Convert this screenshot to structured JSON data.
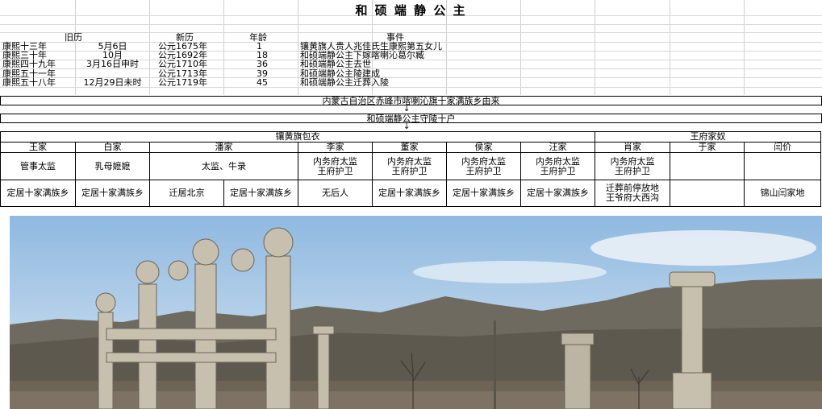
{
  "title": "和 硕 端 静 公 主",
  "timeline": {
    "headers": {
      "old_cal": "旧历",
      "new_cal": "新历",
      "age": "年龄",
      "event": "事件"
    },
    "rows": [
      {
        "reign": "康熙十三年",
        "date": "5月6日",
        "year": "公元1675年",
        "age": "1",
        "event": "镶黄旗人贵人兆佳氏生康熙第五女儿"
      },
      {
        "reign": "康熙三十年",
        "date": "10月",
        "year": "公元1692年",
        "age": "18",
        "event": "和硕端静公主下嫁喀喇沁葛尔臧"
      },
      {
        "reign": "康熙四十九年",
        "date": "3月16日申时",
        "year": "公元1710年",
        "age": "36",
        "event": "和硕端静公主去世"
      },
      {
        "reign": "康熙五十一年",
        "date": "",
        "year": "公元1713年",
        "age": "39",
        "event": "和硕端静公主陵建成"
      },
      {
        "reign": "康熙五十八年",
        "date": "12月29日未时",
        "year": "公元1719年",
        "age": "45",
        "event": "和硕端静公主迁葬入陵"
      }
    ]
  },
  "origin": {
    "line1": "内蒙古自治区赤峰市喀喇沁旗十家满族乡由来",
    "arrow": "↓",
    "line2": "和硕端静公主守陵十户"
  },
  "family": {
    "groups": {
      "left": "镶黄旗包衣",
      "right": "王府家奴"
    },
    "names": [
      "王家",
      "白家",
      "潘家",
      "李家",
      "董家",
      "侯家",
      "汪家",
      "肖家",
      "于家",
      "闫价"
    ],
    "roles": [
      "管事太监",
      "乳母嬷嬷",
      "太监、牛录",
      "内务府太监\n王府护卫",
      "内务府太监\n王府护卫",
      "内务府太监\n王府护卫",
      "内务府太监\n王府护卫",
      "内务府太监\n王府护卫",
      "",
      ""
    ],
    "places": [
      "定居十家满族乡",
      "定居十家满族乡",
      "迁居北京",
      "定居十家满族乡",
      "无后人",
      "定居十家满族乡",
      "定居十家满族乡",
      "定居十家满族乡",
      "迁葬前停放地\n王爷府大西沟",
      "",
      "锦山闫家地"
    ]
  },
  "photo": {
    "colors": {
      "sky": "#9ec4e6",
      "mountain": "#7a7468",
      "stone": "#c9c2b2"
    }
  }
}
